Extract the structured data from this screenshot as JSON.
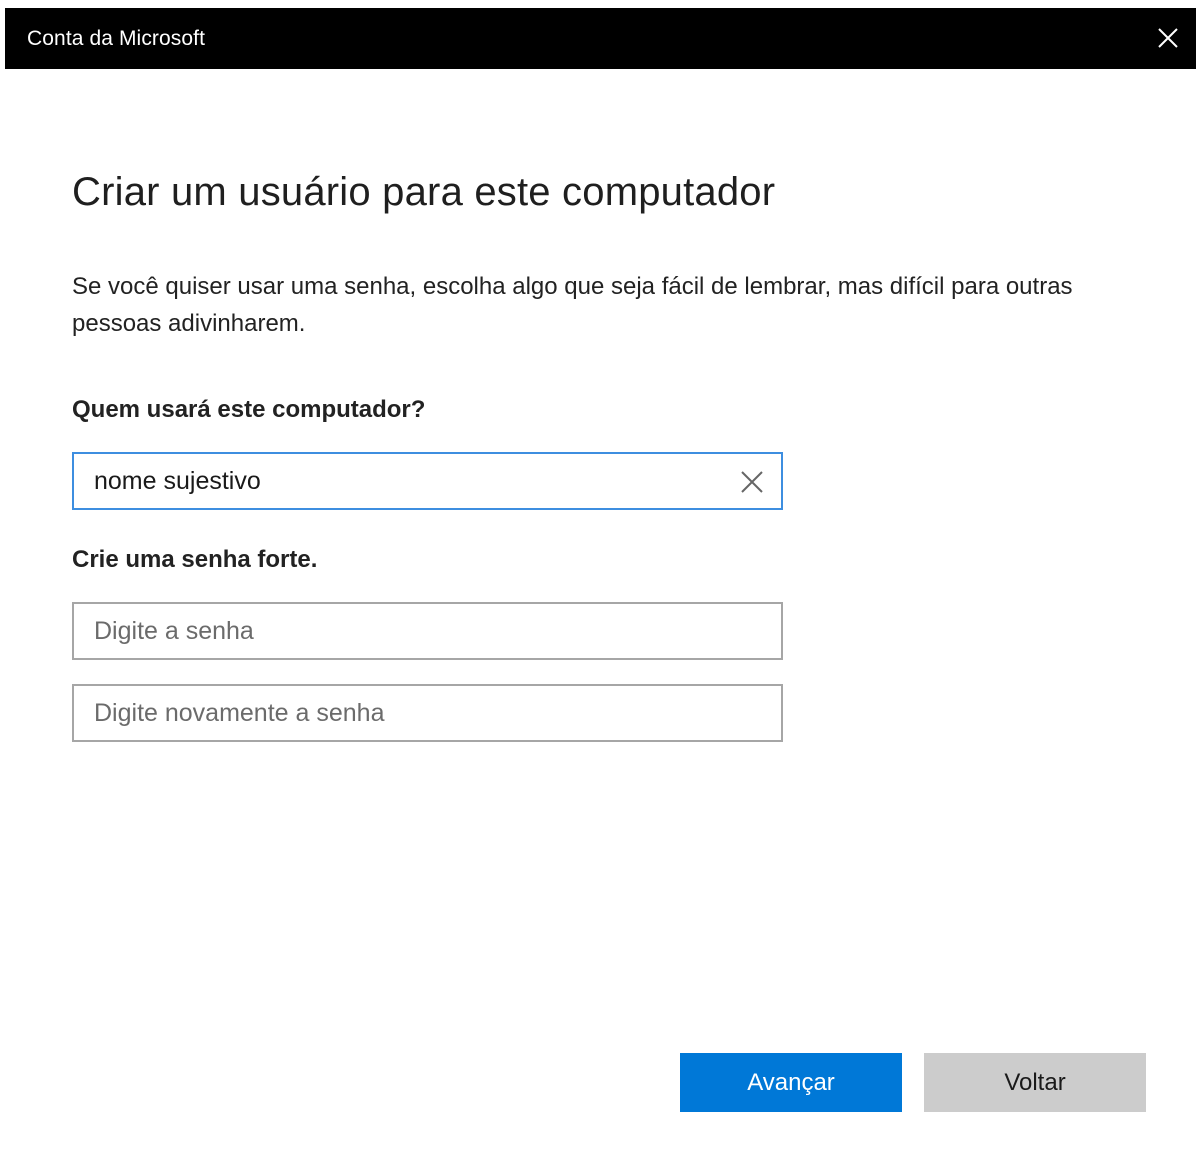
{
  "window": {
    "title": "Conta da Microsoft"
  },
  "page": {
    "heading": "Criar um usuário para este computador",
    "description": "Se você quiser usar uma senha, escolha algo que seja fácil de lembrar, mas difícil para outras pessoas adivinharem."
  },
  "user": {
    "label": "Quem usará este computador?",
    "value": "nome sujestivo"
  },
  "password": {
    "label": "Crie uma senha forte.",
    "placeholder": "Digite a senha",
    "confirm_placeholder": "Digite novamente a senha"
  },
  "buttons": {
    "next": "Avançar",
    "back": "Voltar"
  },
  "colors": {
    "titlebar": "#000000",
    "accent": "#0078d7",
    "focus_border": "#3d8ee0",
    "secondary_button": "#cccccc"
  },
  "icons": {
    "close": "close-icon",
    "clear": "clear-icon"
  }
}
